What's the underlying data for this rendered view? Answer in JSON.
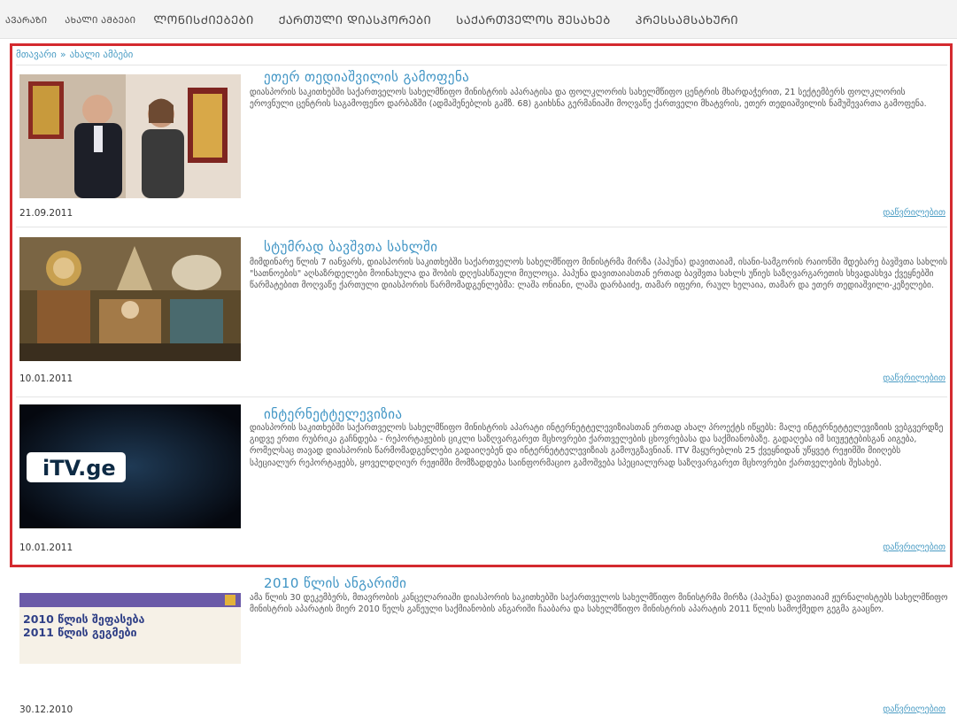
{
  "nav": {
    "items": [
      {
        "label": "ᲐᲕᲐᲠᲐᲖᲘ",
        "size": "sm"
      },
      {
        "label": "ᲐᲮᲐᲚᲘ ᲐᲛᲑᲔᲑᲘ",
        "size": "sm"
      },
      {
        "label": "ᲚᲝᲜᲘᲡᲫᲘᲔᲑᲔᲑᲘ",
        "size": "lg"
      },
      {
        "label": "ᲥᲐᲠᲗᲣᲚᲘ ᲓᲘᲐᲡᲞᲝᲠᲔᲑᲘ",
        "size": "lg"
      },
      {
        "label": "ᲡᲐᲥᲐᲠᲗᲕᲔᲚᲝᲡ ᲨᲔᲡᲐᲮᲔᲑ",
        "size": "lg"
      },
      {
        "label": "ᲞᲠᲔᲡᲡᲐᲛᲡᲐᲮᲣᲠᲘ",
        "size": "lg"
      }
    ]
  },
  "breadcrumb": {
    "home": "მთავარი",
    "sep": "»",
    "current": "ახალი ამბები"
  },
  "news": [
    {
      "title": "ეთერ თედიაშვილის გამოფენა",
      "body": "დიასპორის საკითხებში საქართველოს სახელმწიფო მინისტრის აპარატისა და ფოლკლორის სახელმწიფო ცენტრის მხარდაჭერით, 21 სექტემბერს ფოლკლორის ეროვნული ცენტრის საგამოფენო დარბაზში (ადმაშენებლის გამზ. 68) გაიხსნა გერმანიაში მოღვაწე ქართველი მხატვრის, ეთერ თედიაშვილის ნამუშევართა გამოფენა.",
      "date": "21.09.2011",
      "more": "დაწვრილებით"
    },
    {
      "title": "სტუმრად ბავშვთა სახლში",
      "body": "მიმდინარე წლის 7 იანვარს, დიასპორის საკითხებში საქართველოს სახელმწიფო მინისტრმა მირზა (პაპუნა) დავითაიამ, ისანი-სამგორის რაიონში მდებარე ბავშვთა სახლის \"სათნოების\" აღსაზრდელები მოინახულა და შობის დღესასწაული მიულოცა. პაპუნა დავითაიასთან ერთად ბავშვთა სახლს უწიეს საზღვარგარეთის სხვადასხვა ქვეყნებში წარმატებით მოღვაწე ქართული დიასპორის წარმომადგენლებმა: ლაშა ონიანი, ლაშა დარბაიძე, თამარ იფერი, რაულ ხელაია, თამარ და ეთერ თედიაშვილი-კეზელები.",
      "date": "10.01.2011",
      "more": "დაწვრილებით"
    },
    {
      "title": "ინტერნეტტელევიზია",
      "body": "დიასპორის საკითხებში საქართველოს სახელმწიფო მინისტრის აპარატი ინტერნეტტელევიზიასთან ერთად ახალ პროექტს იწყებს: მალე ინტერნეტტელევიზიის ვებგვერდზე გიდვე ერთი რუბრიკა გაჩნდება - რეპორტაჟების ციკლი საზღვარგარეთ მცხოვრები ქართველების ცხოვრებასა და საქმიანობაზე. გადაღება იმ სიუჟეტებისგან აიგება, რომელსაც თავად დიასპორის წარმომადგენლები გადაიღებენ და ინტერნეტტელევიზიას გამოუგზავნიან. ITV მაყურებლის 25 ქვეყნიდან უწყვეტ რეჟიმში მიიღებს სპეციალურ რეპორტაჟებს, ყოველდღიურ რეჟიმში მომზადდება საინფორმაციო გამოშვება სპეციალურად საზღვარგარეთ მცხოვრები ქართველების შესახებ.",
      "date": "10.01.2011",
      "more": "დაწვრილებით",
      "logo_text": "iTV.ge"
    },
    {
      "title": "2010 წლის ანგარიში",
      "body": "ამა წლის 30 დეკემბერს, მთავრობის კანცელარიაში დიასპორის საკითხებში საქართველოს სახელმწიფო მინისტრმა მირზა (პაპუნა) დავითაიამ ჟურნალისტებს სახელმწიფო მინისტრის აპარატის მიერ 2010 წელს გაწეული საქმიანობის ანგარიში ჩააბარა და სახელმწიფო მინისტრის აპარატის 2011 წლის სამოქმედო გეგმა გააცნო.",
      "date": "30.12.2010",
      "more": "დაწვრილებით",
      "report_line1": "2010 წლის შეფასება",
      "report_line2": "2011 წლის გეგმები"
    }
  ],
  "colors": {
    "frame": "#d42a2f",
    "link": "#4a9cc4",
    "title": "#3f94c4",
    "text": "#555555"
  }
}
